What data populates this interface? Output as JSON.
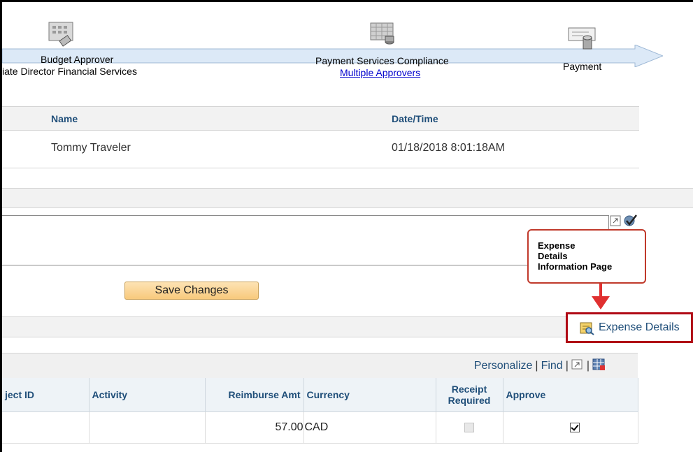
{
  "workflow": {
    "steps": [
      {
        "title": "Budget Approver",
        "subtitle": "iate Director Financial Services",
        "icon": "calculator-icon"
      },
      {
        "title": "Payment Services Compliance",
        "link": "Multiple Approvers",
        "icon": "ledger-icon"
      },
      {
        "title": "Payment",
        "icon": "payment-icon"
      }
    ]
  },
  "history": {
    "columns": {
      "name": "Name",
      "datetime": "Date/Time"
    },
    "rows": [
      {
        "name": "Tommy Traveler",
        "datetime": "01/18/2018  8:01:18AM"
      }
    ]
  },
  "callout": {
    "lines": [
      "Expense",
      "Details",
      "Information Page"
    ],
    "color": "#c0392b"
  },
  "actions": {
    "save_label": "Save Changes",
    "expense_details_label": "Expense Details"
  },
  "grid": {
    "toolbar": {
      "personalize": "Personalize",
      "find": "Find",
      "sep": "|"
    },
    "columns": [
      "ject ID",
      "Activity",
      "Reimburse Amt",
      "Currency",
      "Receipt Required",
      "Approve"
    ],
    "rows": [
      {
        "project_id": "",
        "activity": "",
        "reimburse_amt": "57.00",
        "currency": "CAD",
        "receipt_required": false,
        "approve": true
      }
    ]
  },
  "colors": {
    "link": "#1f4e79",
    "highlight_box": "#b00a15",
    "arrow": "#dce9f7"
  }
}
